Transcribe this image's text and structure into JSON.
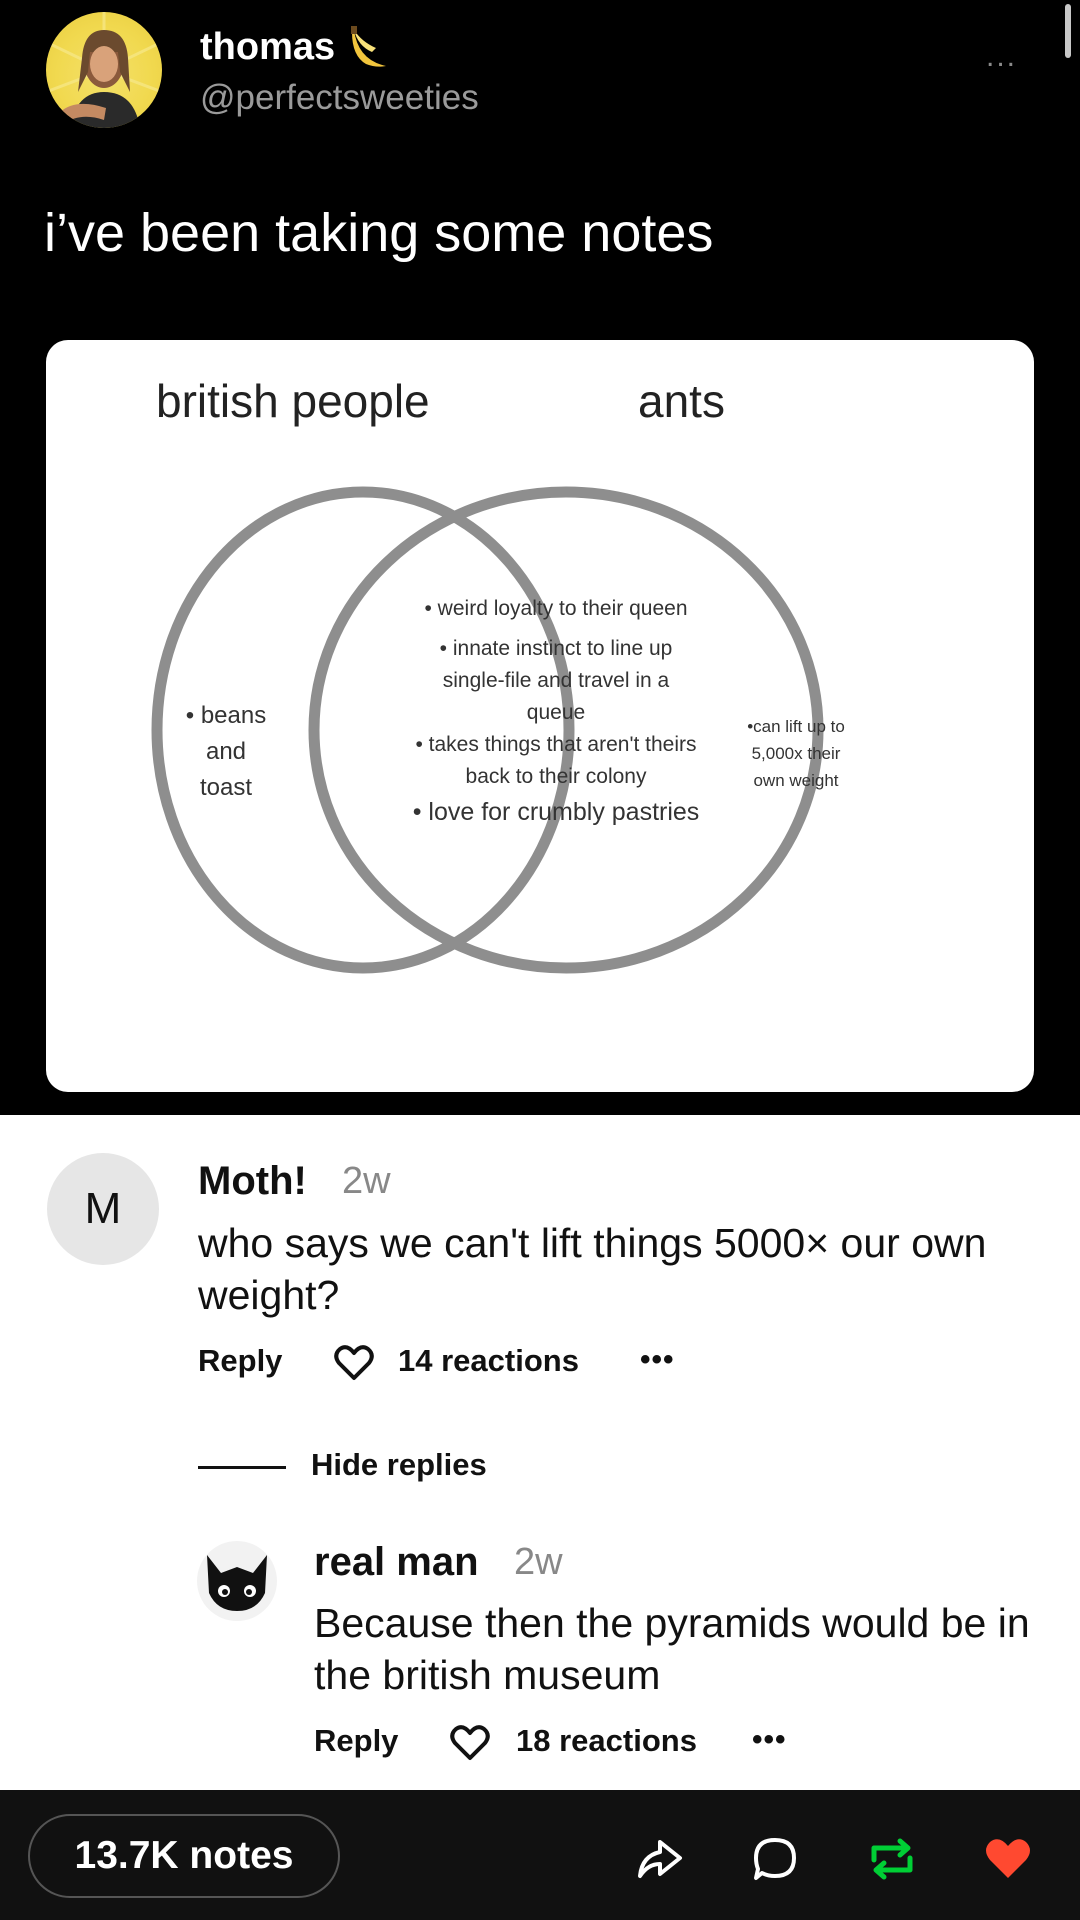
{
  "post": {
    "author_name": "thomas",
    "author_handle": "@perfectsweeties",
    "more_label": "...",
    "text": "i’ve been taking some notes"
  },
  "venn": {
    "left_title": "british people",
    "right_title": "ants",
    "left_only": [
      "• beans",
      "and",
      "toast"
    ],
    "overlap": [
      {
        "text": "• weird loyalty to their queen",
        "big": false
      },
      {
        "text": "• innate instinct to line up",
        "big": false
      },
      {
        "text": "single-file and travel in a",
        "big": false
      },
      {
        "text": "queue",
        "big": false
      },
      {
        "text": "• takes things that aren't theirs",
        "big": false
      },
      {
        "text": "back to their colony",
        "big": false
      },
      {
        "text": "• love for crumbly pastries",
        "big": true
      }
    ],
    "right_only": [
      "•can lift up to",
      "5,000x their",
      "own weight"
    ],
    "circle_color": "#8e8e8e"
  },
  "comments": [
    {
      "avatar_letter": "M",
      "name": "Moth!",
      "time": "2w",
      "body": "who says we can't lift things 5000× our own weight?",
      "reply_label": "Reply",
      "reactions": "14 reactions",
      "more_label": "•••"
    },
    {
      "name": "real man",
      "time": "2w",
      "body": "Because then the pyramids would be in the british museum",
      "reply_label": "Reply",
      "reactions": "18 reactions",
      "more_label": "•••"
    }
  ],
  "hide_replies_label": "Hide replies",
  "bottom_bar": {
    "notes_label": "13.7K notes",
    "icons": [
      "share-icon",
      "comment-icon",
      "reblog-icon",
      "like-heart-icon"
    ],
    "reblog_color": "#00cf35",
    "like_color": "#ff4930"
  }
}
